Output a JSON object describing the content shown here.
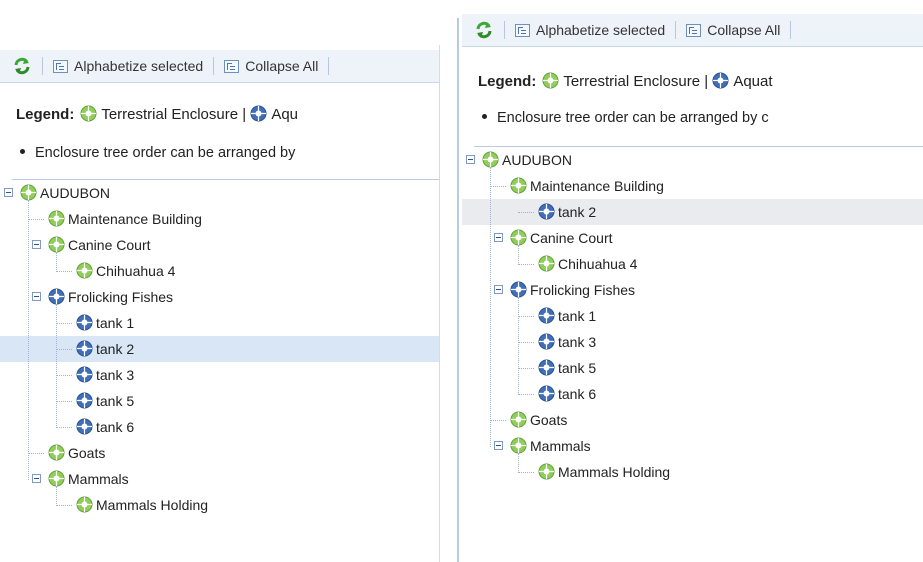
{
  "colors": {
    "toolbar_bg": "#eef3fa",
    "selected_row": "#d9e6f6",
    "terrestrial_icon": "#8fcf57",
    "aquatic_icon": "#3f6fb8",
    "refresh_icon": "#3aa832"
  },
  "icons": {
    "refresh": "refresh-arrows-icon",
    "tree_button": "tree-structure-icon",
    "terrestrial": "terrestrial-enclosure-icon",
    "aquatic": "aquatic-enclosure-icon",
    "collapse": "minus-box-icon"
  },
  "left": {
    "toolbar": {
      "alphabetize_label": "Alphabetize selected",
      "collapse_label": "Collapse All"
    },
    "legend": {
      "label": "Legend:",
      "terrestrial": "Terrestrial Enclosure",
      "separator": "|",
      "aquatic": "Aqu"
    },
    "note": "Enclosure tree order can be arranged by",
    "tree": [
      {
        "label": "AUDUBON",
        "type": "terrestrial",
        "depth": 0,
        "expanded": true
      },
      {
        "label": "Maintenance Building",
        "type": "terrestrial",
        "depth": 1,
        "expanded": false
      },
      {
        "label": "Canine Court",
        "type": "terrestrial",
        "depth": 1,
        "expanded": true
      },
      {
        "label": "Chihuahua 4",
        "type": "terrestrial",
        "depth": 2,
        "expanded": false
      },
      {
        "label": "Frolicking Fishes",
        "type": "aquatic",
        "depth": 1,
        "expanded": true
      },
      {
        "label": "tank 1",
        "type": "aquatic",
        "depth": 2,
        "expanded": false
      },
      {
        "label": "tank 2",
        "type": "aquatic",
        "depth": 2,
        "expanded": false,
        "selected": true
      },
      {
        "label": "tank 3",
        "type": "aquatic",
        "depth": 2,
        "expanded": false
      },
      {
        "label": "tank 5",
        "type": "aquatic",
        "depth": 2,
        "expanded": false
      },
      {
        "label": "tank 6",
        "type": "aquatic",
        "depth": 2,
        "expanded": false
      },
      {
        "label": "Goats",
        "type": "terrestrial",
        "depth": 1,
        "expanded": false
      },
      {
        "label": "Mammals",
        "type": "terrestrial",
        "depth": 1,
        "expanded": true
      },
      {
        "label": "Mammals Holding",
        "type": "terrestrial",
        "depth": 2,
        "expanded": false
      }
    ]
  },
  "right": {
    "toolbar": {
      "alphabetize_label": "Alphabetize selected",
      "collapse_label": "Collapse All"
    },
    "legend": {
      "label": "Legend:",
      "terrestrial": "Terrestrial Enclosure",
      "separator": "|",
      "aquatic": "Aquat"
    },
    "note": "Enclosure tree order can be arranged by c",
    "tree": [
      {
        "label": "AUDUBON",
        "type": "terrestrial",
        "depth": 0,
        "expanded": true
      },
      {
        "label": "Maintenance Building",
        "type": "terrestrial",
        "depth": 1,
        "expanded": false
      },
      {
        "label": "tank 2",
        "type": "aquatic",
        "depth": 2,
        "expanded": false,
        "selected": true
      },
      {
        "label": "Canine Court",
        "type": "terrestrial",
        "depth": 1,
        "expanded": true
      },
      {
        "label": "Chihuahua 4",
        "type": "terrestrial",
        "depth": 2,
        "expanded": false
      },
      {
        "label": "Frolicking Fishes",
        "type": "aquatic",
        "depth": 1,
        "expanded": true
      },
      {
        "label": "tank 1",
        "type": "aquatic",
        "depth": 2,
        "expanded": false
      },
      {
        "label": "tank 3",
        "type": "aquatic",
        "depth": 2,
        "expanded": false
      },
      {
        "label": "tank 5",
        "type": "aquatic",
        "depth": 2,
        "expanded": false
      },
      {
        "label": "tank 6",
        "type": "aquatic",
        "depth": 2,
        "expanded": false
      },
      {
        "label": "Goats",
        "type": "terrestrial",
        "depth": 1,
        "expanded": false
      },
      {
        "label": "Mammals",
        "type": "terrestrial",
        "depth": 1,
        "expanded": true
      },
      {
        "label": "Mammals Holding",
        "type": "terrestrial",
        "depth": 2,
        "expanded": false
      }
    ]
  }
}
